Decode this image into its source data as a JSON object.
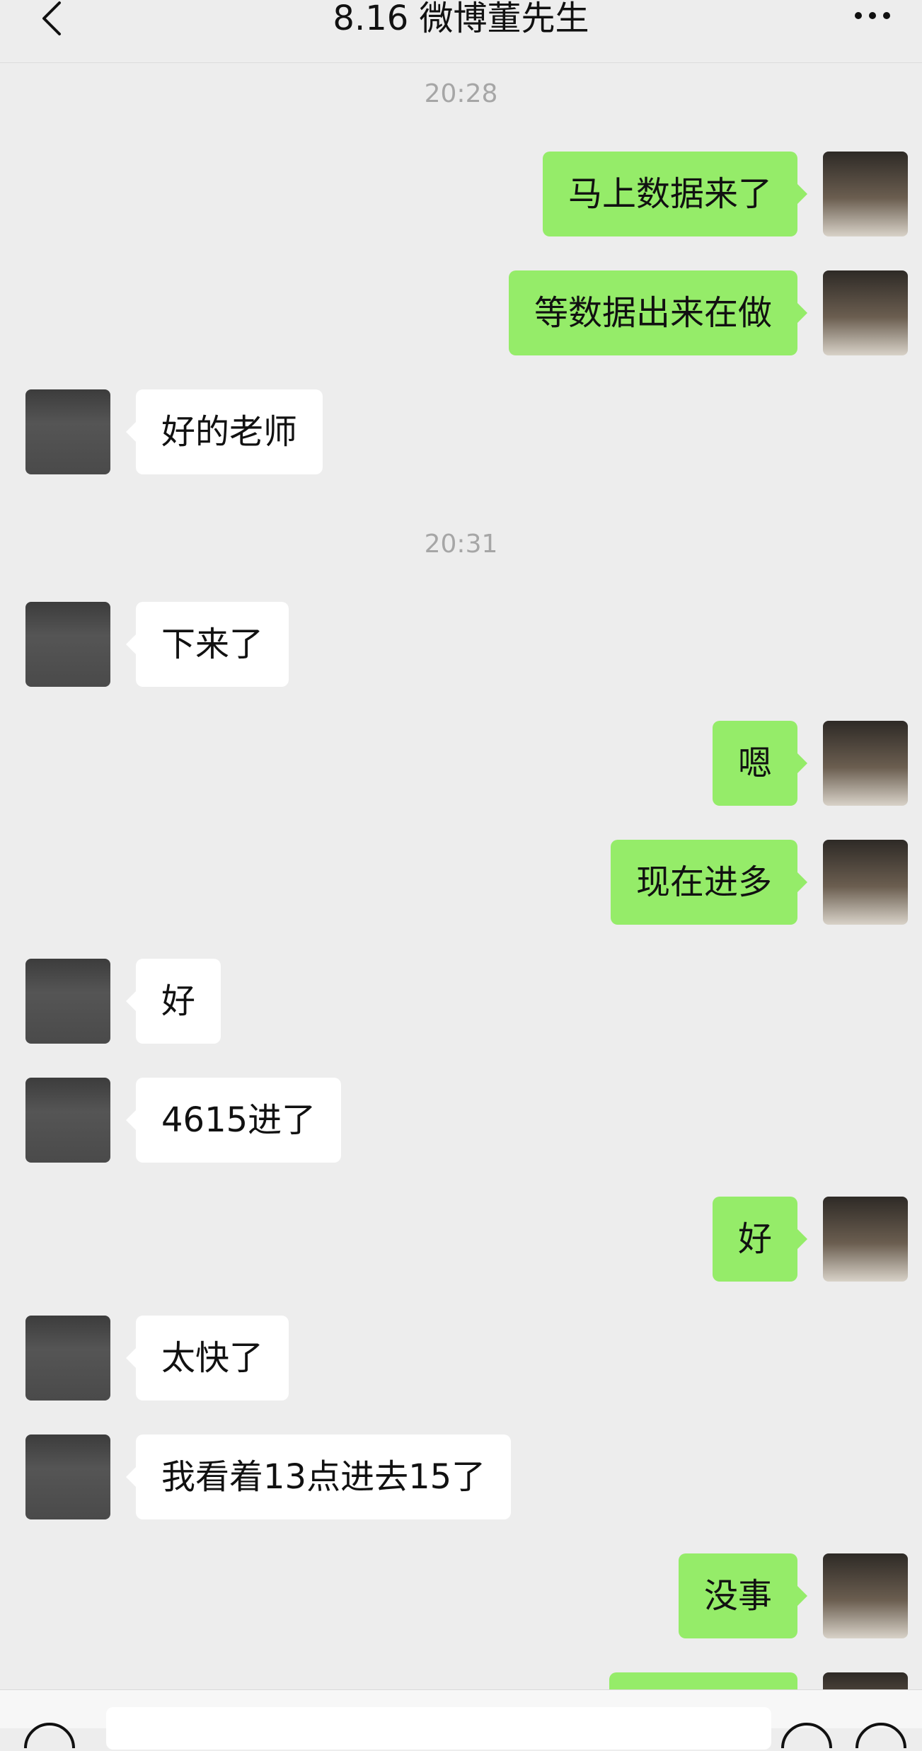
{
  "header": {
    "title": "8.16 微博董先生",
    "back_icon": "chevron-left-icon",
    "more_icon": "more-dots-icon"
  },
  "timestamps": [
    "20:28",
    "20:31"
  ],
  "messages": [
    {
      "side": "right",
      "text": "马上数据来了"
    },
    {
      "side": "right",
      "text": "等数据出来在做"
    },
    {
      "side": "left",
      "text": "好的老师"
    },
    {
      "side": "left",
      "text": "下来了"
    },
    {
      "side": "right",
      "text": "嗯"
    },
    {
      "side": "right",
      "text": "现在进多"
    },
    {
      "side": "left",
      "text": "好"
    },
    {
      "side": "left",
      "text": "4615进了"
    },
    {
      "side": "right",
      "text": "好"
    },
    {
      "side": "left",
      "text": "太快了"
    },
    {
      "side": "left",
      "text": "我看着13点进去15了"
    },
    {
      "side": "right",
      "text": "没事"
    }
  ],
  "colors": {
    "background": "#ededed",
    "sent_bubble": "#95ec69",
    "received_bubble": "#ffffff",
    "timestamp": "#a6a6a6"
  },
  "input_bar": {
    "voice_icon": "voice-icon",
    "emoji_icon": "emoji-icon",
    "plus_icon": "plus-icon"
  }
}
